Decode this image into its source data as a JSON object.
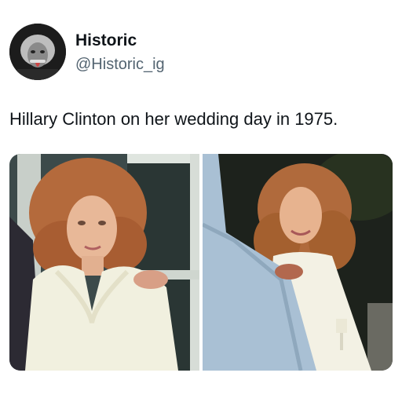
{
  "account": {
    "display_name": "Historic",
    "handle": "@Historic_ig",
    "avatar_icon": "portrait-avatar-icon"
  },
  "tweet": {
    "text": "Hillary Clinton on her wedding day in 1975."
  },
  "media": {
    "images": [
      {
        "name": "wedding-photo-left"
      },
      {
        "name": "wedding-photo-right"
      }
    ]
  }
}
